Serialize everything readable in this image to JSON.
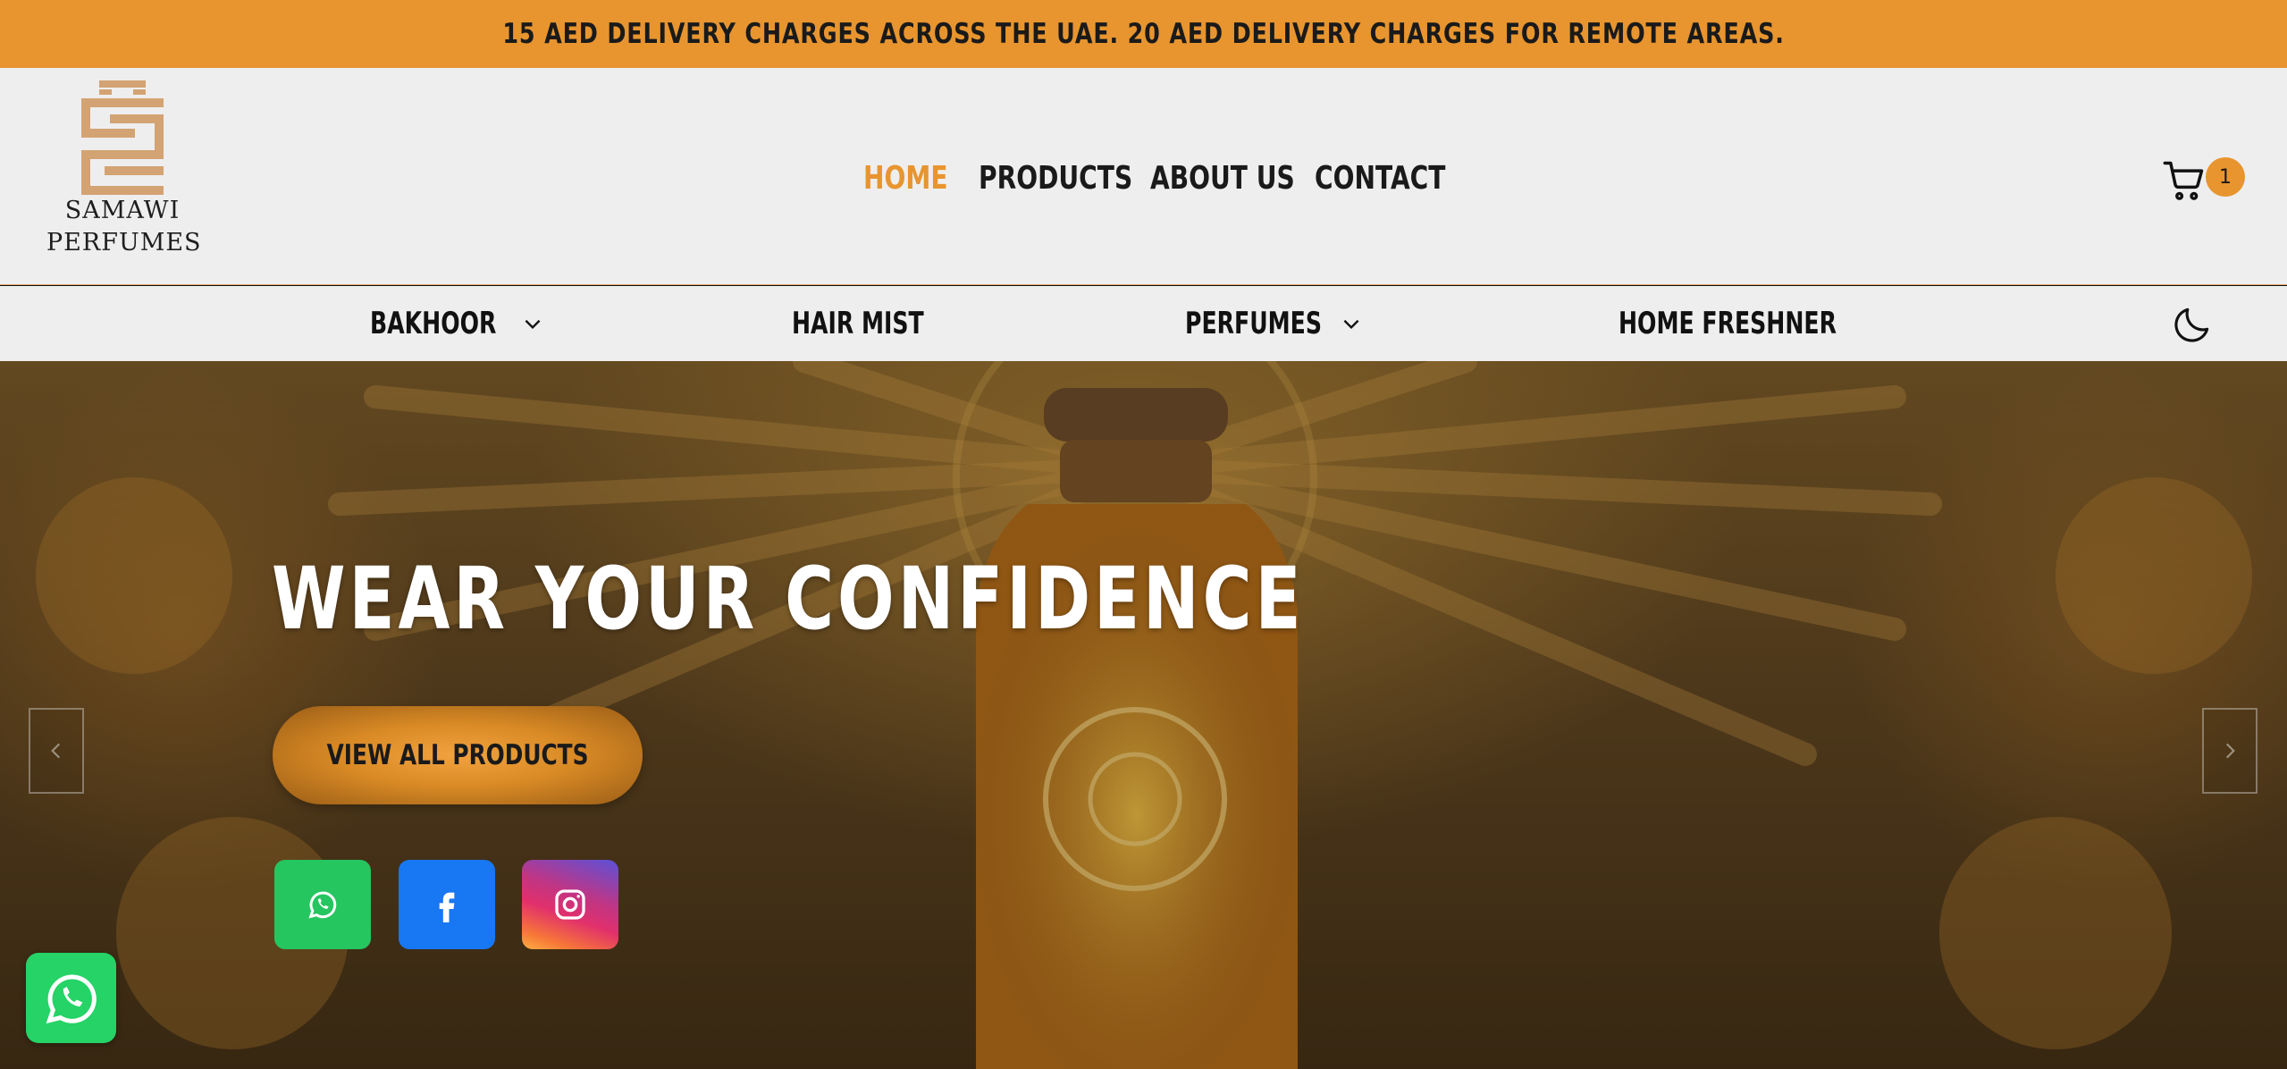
{
  "announcement": {
    "text": "15 AED DELIVERY CHARGES ACROSS THE UAE. 20 AED DELIVERY CHARGES FOR REMOTE AREAS."
  },
  "brand": {
    "line1": "SAMAWI",
    "line2": "PERFUMES",
    "logo_color": "#d4a373"
  },
  "main_nav": {
    "items": [
      {
        "label": "HOME",
        "active": true
      },
      {
        "label": "PRODUCTS",
        "active": false
      },
      {
        "label": "ABOUT US",
        "active": false
      },
      {
        "label": "CONTACT",
        "active": false
      }
    ]
  },
  "cart": {
    "icon": "cart-icon",
    "count": "1"
  },
  "categories": {
    "items": [
      {
        "label": "BAKHOOR",
        "has_dropdown": true
      },
      {
        "label": "HAIR MIST",
        "has_dropdown": false
      },
      {
        "label": "PERFUMES",
        "has_dropdown": true
      },
      {
        "label": "HOME FRESHNER",
        "has_dropdown": false
      }
    ],
    "theme_toggle_icon": "moon-icon"
  },
  "hero": {
    "title": "WEAR YOUR CONFIDENCE",
    "cta_label": "VIEW ALL PRODUCTS",
    "social": [
      {
        "name": "whatsapp",
        "icon": "whatsapp-icon",
        "color": "#25c55f"
      },
      {
        "name": "facebook",
        "icon": "facebook-icon",
        "color": "#1877f2"
      },
      {
        "name": "instagram",
        "icon": "instagram-icon",
        "color": "#e1306c"
      }
    ],
    "prev_icon": "chevron-left-icon",
    "next_icon": "chevron-right-icon"
  },
  "floating_chat": {
    "icon": "whatsapp-icon",
    "color": "#25d366"
  },
  "colors": {
    "accent": "#e8952f",
    "header_bg": "#eeeeee",
    "text_dark": "#1a1a1a"
  }
}
